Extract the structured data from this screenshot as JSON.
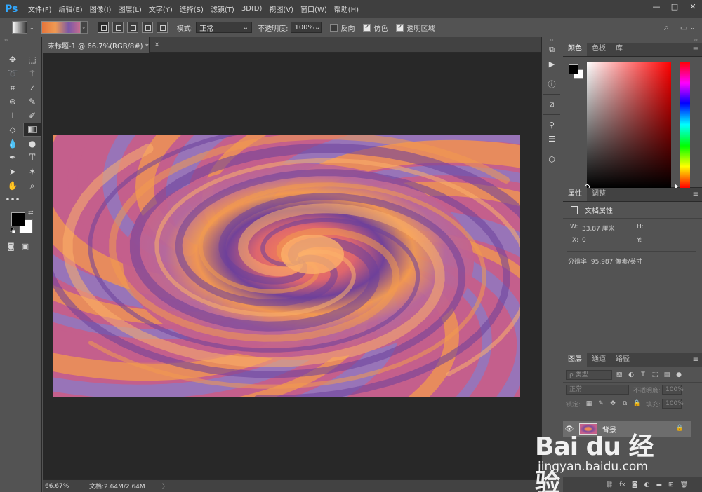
{
  "app": {
    "logo": "Ps"
  },
  "menu": [
    "文件(F)",
    "编辑(E)",
    "图像(I)",
    "图层(L)",
    "文字(Y)",
    "选择(S)",
    "滤镜(T)",
    "3D(D)",
    "视图(V)",
    "窗口(W)",
    "帮助(H)"
  ],
  "window_controls": {
    "minimize": "—",
    "restore": "□",
    "close": "✕"
  },
  "options": {
    "mode_label": "模式:",
    "mode_value": "正常",
    "opacity_label": "不透明度:",
    "opacity_value": "100%",
    "reverse_label": "反向",
    "dither_label": "仿色",
    "transparency_label": "透明区域",
    "reverse_checked": false,
    "dither_checked": true,
    "transparency_checked": true
  },
  "document": {
    "tab_title": "未标题-1 @ 66.7%(RGB/8#) *",
    "close": "×",
    "status_zoom": "66.67%",
    "status_doc": "文档:2.64M/2.64M",
    "status_arrow": "〉"
  },
  "toolbox": {
    "icons": [
      "move-icon",
      "marquee-icon",
      "lasso-icon",
      "magic-wand-icon",
      "crop-icon",
      "eyedropper-icon",
      "spot-healing-icon",
      "brush-icon",
      "clone-stamp-icon",
      "history-brush-icon",
      "eraser-icon",
      "gradient-icon",
      "blur-icon",
      "dodge-icon",
      "pen-icon",
      "type-icon",
      "path-select-icon",
      "shape-icon",
      "hand-icon",
      "zoom-icon",
      "more-tools-icon"
    ],
    "active": "gradient-icon",
    "foreground": "#000000",
    "background": "#ffffff"
  },
  "color_panel": {
    "tabs": [
      "颜色",
      "色板",
      "库"
    ],
    "active_tab": "颜色",
    "fg": "#000000",
    "bg": "#ffffff",
    "hue": "#ff0000"
  },
  "properties_panel": {
    "tabs": [
      "属性",
      "调整"
    ],
    "active_tab": "属性",
    "title": "文档属性",
    "w_label": "W:",
    "w_value": "33.87 厘米",
    "h_label": "H:",
    "x_label": "X:",
    "x_value": "0",
    "y_label": "Y:",
    "resolution": "分辨率: 95.987 像素/英寸"
  },
  "layers_panel": {
    "tabs": [
      "图层",
      "通道",
      "路径"
    ],
    "active_tab": "图层",
    "kind": "ρ 类型",
    "blend": "正常",
    "opacity_label": "不透明度:",
    "opacity_value": "100%",
    "lock_label": "锁定:",
    "fill_label": "填充:",
    "fill_value": "100%",
    "layers": [
      {
        "name": "背景",
        "visible": true,
        "locked": true
      }
    ]
  },
  "watermark": {
    "brand": "Bai du 经验",
    "url": "jingyan.baidu.com"
  },
  "colors": {
    "swirl_orange": "#f39a4e",
    "swirl_purple": "#6b3f9a",
    "swirl_pink": "#c45f8c",
    "swirl_blue": "#8a7bc7",
    "center": "#fbb06a"
  }
}
